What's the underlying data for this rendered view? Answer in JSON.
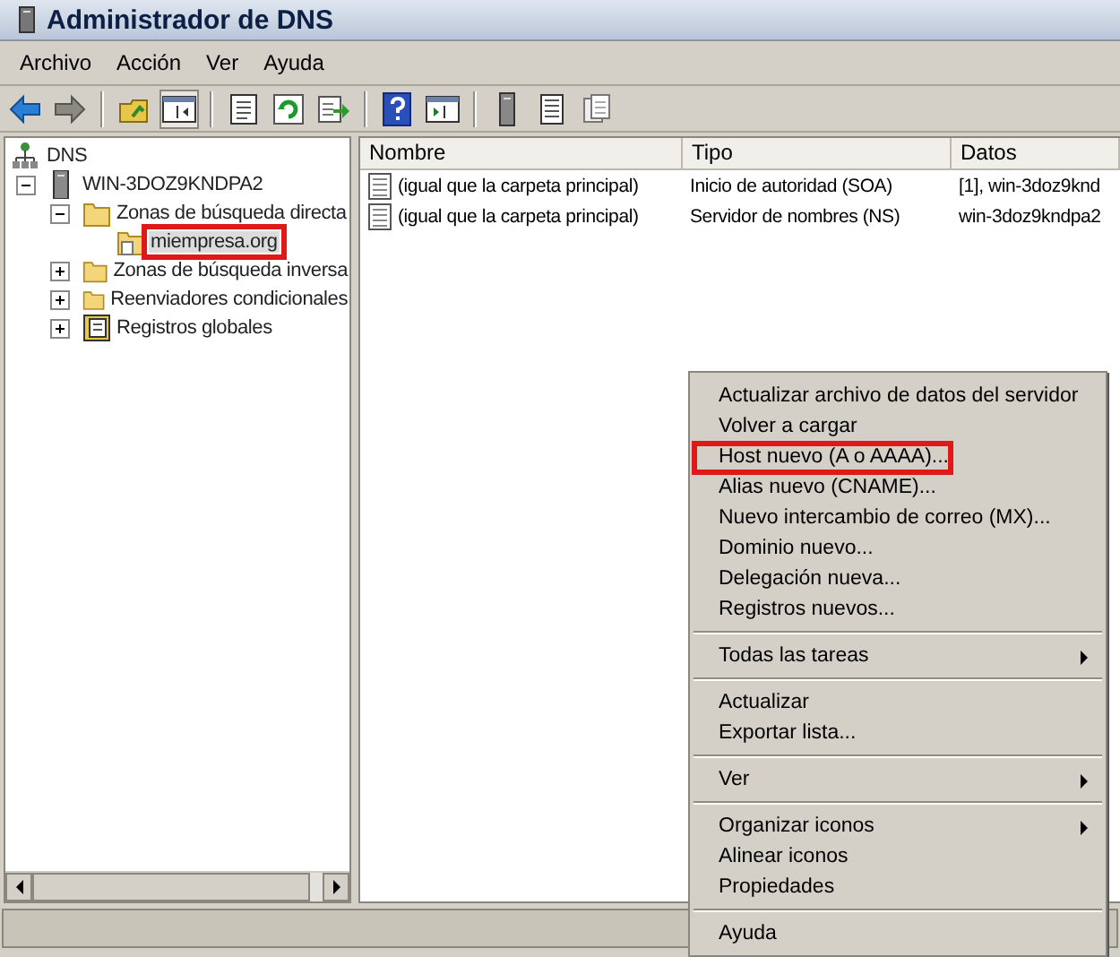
{
  "window": {
    "title": "Administrador de DNS"
  },
  "menu_bar": [
    "Archivo",
    "Acción",
    "Ver",
    "Ayuda"
  ],
  "tree": [
    {
      "label": "DNS",
      "kind": "dns",
      "selected": false,
      "highlighted": false,
      "children": [
        {
          "label": "WIN-3DOZ9KNDPA2",
          "kind": "server",
          "expanded": true,
          "selected": false,
          "highlighted": false,
          "children": [
            {
              "label": "Zonas de búsqueda directa",
              "kind": "folder",
              "expanded": true,
              "selected": false,
              "highlighted": false,
              "children": [
                {
                  "label": "miempresa.org",
                  "kind": "zone",
                  "selected": true,
                  "highlighted": true
                }
              ]
            },
            {
              "label": "Zonas de búsqueda inversa",
              "kind": "folder",
              "expanded": false,
              "selected": false,
              "highlighted": false
            },
            {
              "label": "Reenviadores condicionales",
              "kind": "folder",
              "expanded": false,
              "selected": false,
              "highlighted": false
            },
            {
              "label": "Registros globales",
              "kind": "global",
              "expanded": false,
              "selected": false,
              "highlighted": false
            }
          ]
        }
      ]
    }
  ],
  "table": {
    "columns": [
      "Nombre",
      "Tipo",
      "Datos"
    ],
    "rows": [
      [
        "(igual que la carpeta principal)",
        "Inicio de autoridad (SOA)",
        "[1], win-3doz9knd"
      ],
      [
        "(igual que la carpeta principal)",
        "Servidor de nombres (NS)",
        "win-3doz9kndpa2"
      ]
    ]
  },
  "context_menu": {
    "groups": [
      [
        {
          "label": "Actualizar archivo de datos del servidor",
          "submenu": false,
          "highlighted": false
        },
        {
          "label": "Volver a cargar",
          "submenu": false,
          "highlighted": false
        },
        {
          "label": "Host nuevo (A o AAAA)...",
          "submenu": false,
          "highlighted": true
        },
        {
          "label": "Alias nuevo (CNAME)...",
          "submenu": false,
          "highlighted": false
        },
        {
          "label": "Nuevo intercambio de correo (MX)...",
          "submenu": false,
          "highlighted": false
        },
        {
          "label": "Dominio nuevo...",
          "submenu": false,
          "highlighted": false
        },
        {
          "label": "Delegación nueva...",
          "submenu": false,
          "highlighted": false
        },
        {
          "label": "Registros nuevos...",
          "submenu": false,
          "highlighted": false
        }
      ],
      [
        {
          "label": "Todas las tareas",
          "submenu": true,
          "highlighted": false
        }
      ],
      [
        {
          "label": "Actualizar",
          "submenu": false,
          "highlighted": false
        },
        {
          "label": "Exportar lista...",
          "submenu": false,
          "highlighted": false
        }
      ],
      [
        {
          "label": "Ver",
          "submenu": true,
          "highlighted": false
        }
      ],
      [
        {
          "label": "Organizar iconos",
          "submenu": true,
          "highlighted": false
        },
        {
          "label": "Alinear iconos",
          "submenu": false,
          "highlighted": false
        },
        {
          "label": "Propiedades",
          "submenu": false,
          "highlighted": false
        }
      ],
      [
        {
          "label": "Ayuda",
          "submenu": false,
          "highlighted": false
        }
      ]
    ]
  }
}
